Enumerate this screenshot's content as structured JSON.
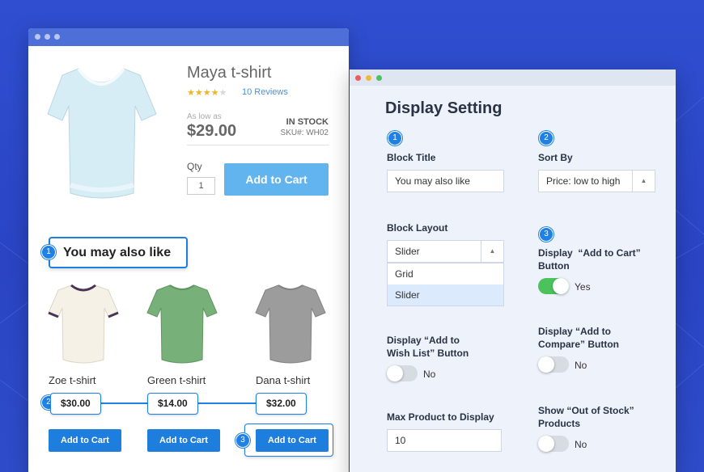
{
  "product": {
    "title": "Maya t-shirt",
    "rating_stars": 4,
    "reviews": "10 Reviews",
    "as_low_as": "As low as",
    "price": "$29.00",
    "stock": "IN STOCK",
    "sku": "SKU#: WH02",
    "qty_label": "Qty",
    "qty_value": "1",
    "add_to_cart": "Add to Cart"
  },
  "related": {
    "title": "You may also like",
    "items": [
      {
        "name": "Zoe t-shirt",
        "price": "$30.00",
        "cart": "Add to Cart"
      },
      {
        "name": "Green t-shirt",
        "price": "$14.00",
        "cart": "Add to Cart"
      },
      {
        "name": "Dana t-shirt",
        "price": "$32.00",
        "cart": "Add to Cart"
      }
    ]
  },
  "badges": {
    "one": "1",
    "two": "2",
    "three": "3"
  },
  "settings": {
    "title": "Display Setting",
    "block_title_label": "Block Title",
    "block_title_value": "You may also like",
    "sort_by_label": "Sort By",
    "sort_by_value": "Price: low to high",
    "block_layout_label": "Block Layout",
    "block_layout_value": "Slider",
    "layout_options": [
      "Grid",
      "Slider"
    ],
    "add_to_cart_label_1": "Display  “Add to Cart”",
    "add_to_cart_label_2": "Button",
    "add_to_cart_state": "Yes",
    "wishlist_label_1": "Display “Add to",
    "wishlist_label_2": "Wish List” Button",
    "wishlist_state": "No",
    "compare_label_1": "Display “Add to",
    "compare_label_2": "Compare” Button",
    "compare_state": "No",
    "max_label": "Max Product to Display",
    "max_value": "10",
    "out_of_stock_label_1": "Show “Out of Stock”",
    "out_of_stock_label_2": "Products",
    "out_of_stock_state": "No"
  },
  "colors": {
    "background": "#2f4fd0",
    "accent": "#1f80e6",
    "toggle_on": "#4bc25b",
    "shirt_white": "#d6edf5",
    "shirt_cream": "#f5f1e6",
    "shirt_green": "#78b07a",
    "shirt_gray": "#9c9c9c"
  }
}
